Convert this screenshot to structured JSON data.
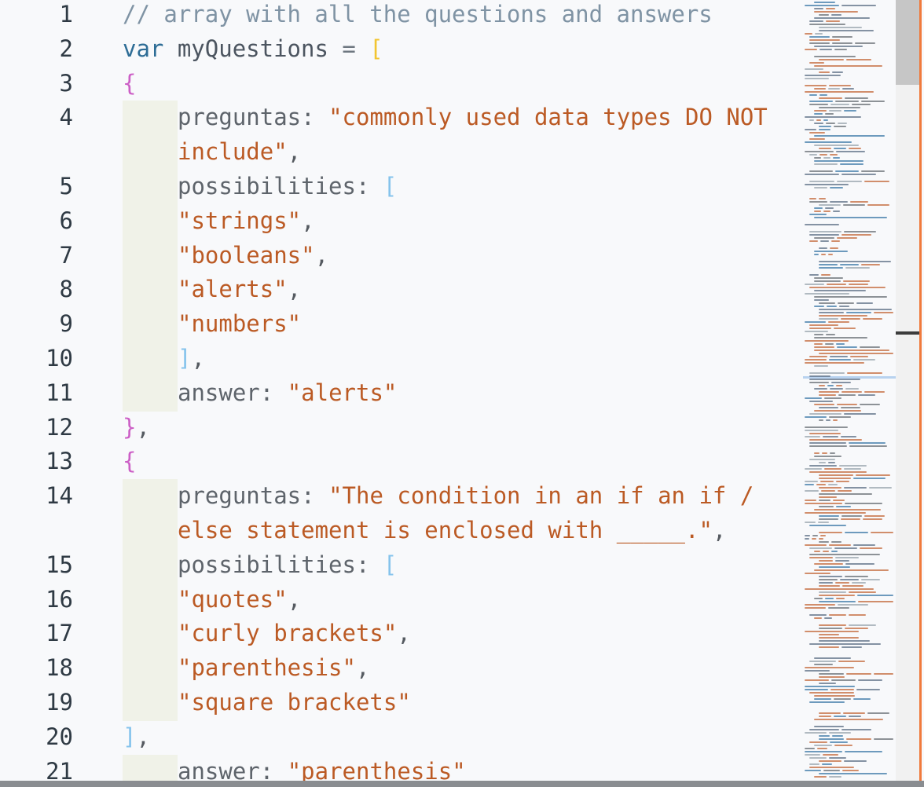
{
  "editor": {
    "lines": [
      {
        "num": "1",
        "tokens": [
          [
            "c-comment",
            "// array with all the questions and answers"
          ]
        ]
      },
      {
        "num": "2",
        "tokens": [
          [
            "c-keyword",
            "var"
          ],
          [
            "c-ident",
            " myQuestions "
          ],
          [
            "c-op",
            "= "
          ],
          [
            "c-bracket-yellow",
            "["
          ]
        ]
      },
      {
        "num": "3",
        "tokens": [
          [
            "c-brace-pink",
            "{"
          ]
        ]
      },
      {
        "num": "4",
        "indent": 1,
        "tokens": [
          [
            "c-prop",
            "preguntas: "
          ],
          [
            "c-str",
            "\"commonly used data types DO NOT"
          ]
        ]
      },
      {
        "num": "",
        "indent": 1,
        "tokens": [
          [
            "c-str",
            "include\""
          ],
          [
            "c-punc",
            ","
          ]
        ]
      },
      {
        "num": "5",
        "indent": 1,
        "tokens": [
          [
            "c-prop",
            "possibilities: "
          ],
          [
            "c-bracket-blue",
            "["
          ]
        ]
      },
      {
        "num": "6",
        "indent": 1,
        "tokens": [
          [
            "c-str",
            "\"strings\""
          ],
          [
            "c-punc",
            ","
          ]
        ]
      },
      {
        "num": "7",
        "indent": 1,
        "tokens": [
          [
            "c-str",
            "\"booleans\""
          ],
          [
            "c-punc",
            ","
          ]
        ]
      },
      {
        "num": "8",
        "indent": 1,
        "tokens": [
          [
            "c-str",
            "\"alerts\""
          ],
          [
            "c-punc",
            ","
          ]
        ]
      },
      {
        "num": "9",
        "indent": 1,
        "tokens": [
          [
            "c-str",
            "\"numbers\""
          ]
        ]
      },
      {
        "num": "10",
        "indent": 1,
        "tokens": [
          [
            "c-bracket-blue",
            "]"
          ],
          [
            "c-punc",
            ","
          ]
        ]
      },
      {
        "num": "11",
        "indent": 1,
        "tokens": [
          [
            "c-prop",
            "answer: "
          ],
          [
            "c-str",
            "\"alerts\""
          ]
        ]
      },
      {
        "num": "12",
        "tokens": [
          [
            "c-brace-pink",
            "}"
          ],
          [
            "c-punc",
            ","
          ]
        ]
      },
      {
        "num": "13",
        "tokens": [
          [
            "c-brace-pink",
            "{"
          ]
        ]
      },
      {
        "num": "14",
        "indent": 1,
        "tokens": [
          [
            "c-prop",
            "preguntas: "
          ],
          [
            "c-str",
            "\"The condition in an if an if /"
          ]
        ]
      },
      {
        "num": "",
        "indent": 1,
        "tokens": [
          [
            "c-str",
            "else statement is enclosed with _____.\""
          ],
          [
            "c-punc",
            ","
          ]
        ]
      },
      {
        "num": "15",
        "indent": 1,
        "tokens": [
          [
            "c-prop",
            "possibilities: "
          ],
          [
            "c-bracket-blue",
            "["
          ]
        ]
      },
      {
        "num": "16",
        "indent": 1,
        "tokens": [
          [
            "c-str",
            "\"quotes\""
          ],
          [
            "c-punc",
            ","
          ]
        ]
      },
      {
        "num": "17",
        "indent": 1,
        "tokens": [
          [
            "c-str",
            "\"curly brackets\""
          ],
          [
            "c-punc",
            ","
          ]
        ]
      },
      {
        "num": "18",
        "indent": 1,
        "tokens": [
          [
            "c-str",
            "\"parenthesis\""
          ],
          [
            "c-punc",
            ","
          ]
        ]
      },
      {
        "num": "19",
        "indent": 1,
        "tokens": [
          [
            "c-str",
            "\"square brackets\""
          ]
        ]
      },
      {
        "num": "20",
        "tokens": [
          [
            "c-bracket-blue",
            "]"
          ],
          [
            "c-punc",
            ","
          ]
        ]
      },
      {
        "num": "21",
        "indent": 1,
        "tokens": [
          [
            "c-prop",
            "answer: "
          ],
          [
            "c-str",
            "\"parenthesis\""
          ]
        ]
      }
    ]
  },
  "colors": {
    "background": "#f8f9fb",
    "comment": "#7f93a4",
    "keyword": "#2e6d96",
    "string": "#bb5a24",
    "brace": "#cc5fc6",
    "bracket_outer": "#f2c531",
    "bracket_inner": "#85c3ec",
    "edge_accent": "#f07a3c"
  }
}
